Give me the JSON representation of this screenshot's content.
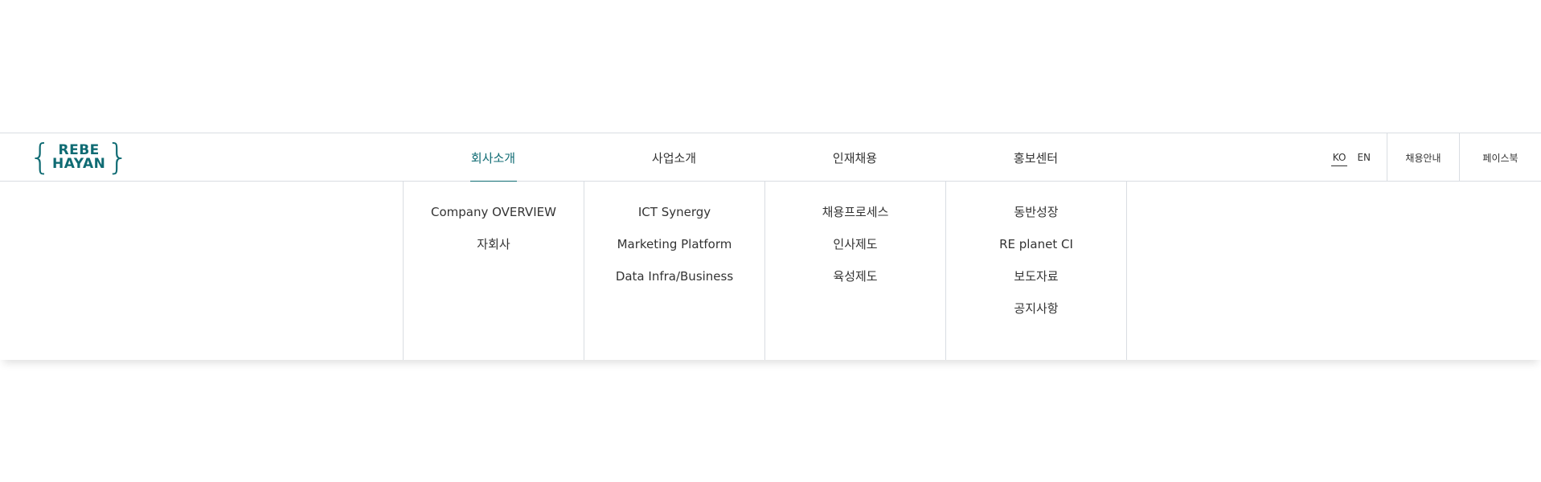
{
  "logo": {
    "line1": "REBE",
    "line2": "HAYAN",
    "brace_left": "{",
    "brace_right": "}",
    "color": "#0f6b73"
  },
  "gnb": {
    "items": [
      {
        "label": "회사소개",
        "active": true
      },
      {
        "label": "사업소개",
        "active": false
      },
      {
        "label": "인재채용",
        "active": false
      },
      {
        "label": "홍보센터",
        "active": false
      }
    ],
    "active_color": "#0f6b73"
  },
  "util": {
    "lang_ko": "KO",
    "lang_en": "EN",
    "current_lang": "KO",
    "recruit": "채용안내",
    "facebook": "페이스북"
  },
  "submenu": {
    "columns": [
      {
        "items": [
          "Company OVERVIEW",
          "자회사"
        ]
      },
      {
        "items": [
          "ICT Synergy",
          "Marketing Platform",
          "Data Infra/Business"
        ]
      },
      {
        "items": [
          "채용프로세스",
          "인사제도",
          "육성제도"
        ]
      },
      {
        "items": [
          "동반성장",
          "RE planet CI",
          "보도자료",
          "공지사항"
        ]
      }
    ]
  }
}
